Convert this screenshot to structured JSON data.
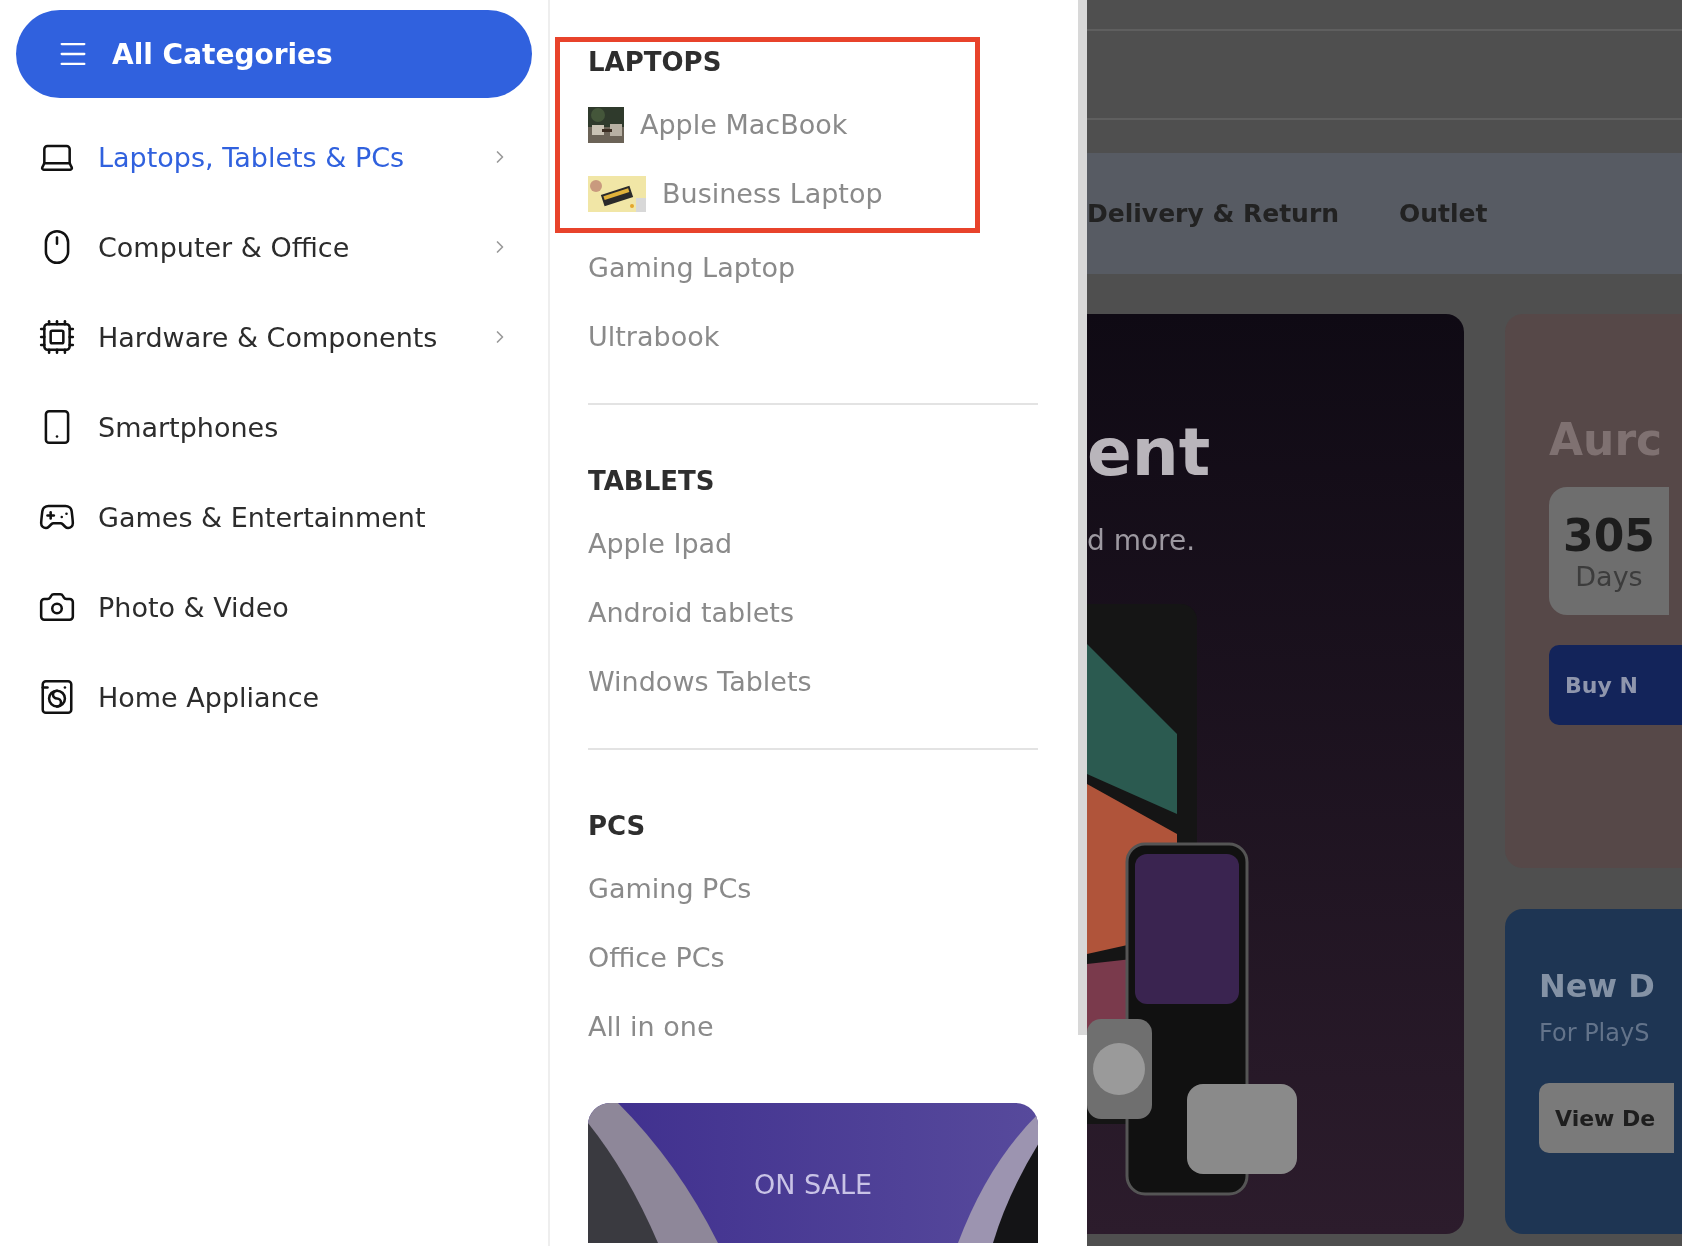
{
  "all_categories_button": {
    "label": "All Categories"
  },
  "categories": [
    {
      "label": "Laptops, Tablets & PCs",
      "selected": true,
      "has_submenu": true
    },
    {
      "label": "Computer & Office",
      "selected": false,
      "has_submenu": true
    },
    {
      "label": "Hardware & Components",
      "selected": false,
      "has_submenu": true
    },
    {
      "label": "Smartphones",
      "selected": false,
      "has_submenu": false
    },
    {
      "label": "Games & Entertainment",
      "selected": false,
      "has_submenu": false
    },
    {
      "label": "Photo & Video",
      "selected": false,
      "has_submenu": false
    },
    {
      "label": "Home Appliance",
      "selected": false,
      "has_submenu": false
    }
  ],
  "submenu": {
    "sections": [
      {
        "heading": "LAPTOPS",
        "highlighted": true,
        "items": [
          {
            "label": "Apple MacBook",
            "kind": "thumb"
          },
          {
            "label": "Business Laptop",
            "kind": "thumb"
          },
          {
            "label": "Gaming Laptop",
            "kind": "text"
          },
          {
            "label": "Ultrabook",
            "kind": "text"
          }
        ]
      },
      {
        "heading": "TABLETS",
        "highlighted": false,
        "items": [
          {
            "label": "Apple Ipad",
            "kind": "text"
          },
          {
            "label": "Android tablets",
            "kind": "text"
          },
          {
            "label": "Windows Tablets",
            "kind": "text"
          }
        ]
      },
      {
        "heading": "PCS",
        "highlighted": false,
        "items": [
          {
            "label": "Gaming PCs",
            "kind": "text"
          },
          {
            "label": "Office PCs",
            "kind": "text"
          },
          {
            "label": "All in one",
            "kind": "text"
          }
        ]
      }
    ],
    "banner": {
      "label": "ON SALE"
    }
  },
  "background": {
    "nav": [
      "Delivery & Return",
      "Outlet"
    ],
    "hero": {
      "title": "ent",
      "subtitle": "d more."
    },
    "promo": {
      "title": "Aurc",
      "count": "305",
      "unit": "Days",
      "button": "Buy N"
    },
    "deal": {
      "title": "New D",
      "subtitle": "For PlayS",
      "button": "View De"
    }
  }
}
